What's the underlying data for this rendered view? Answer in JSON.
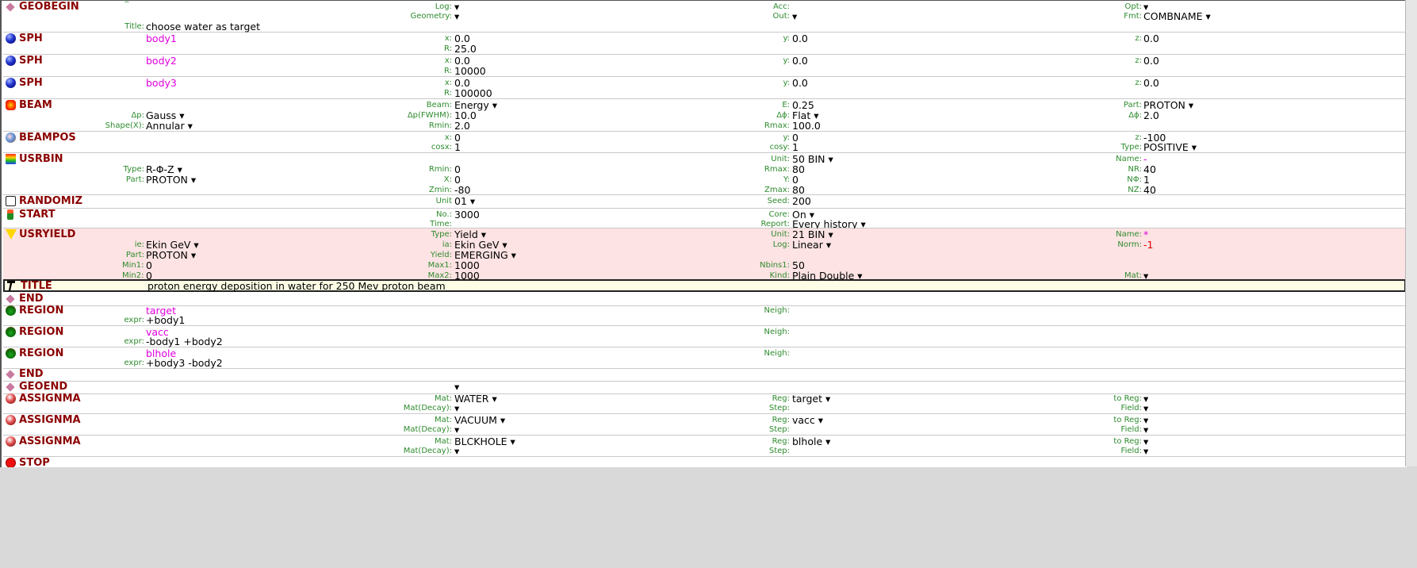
{
  "cards": {
    "geobegin": {
      "name": "GEOBEGIN",
      "log_label": "Log:",
      "log_value": "▾",
      "acc_label": "Acc:",
      "opt_label": "Opt:",
      "opt_value": "▾",
      "geometry_label": "Geometry:",
      "geometry_value": "▾",
      "out_label": "Out:",
      "out_value": "▾",
      "fmt_label": "Fmt:",
      "fmt_value": "COMBNAME ▾",
      "title_label": "Title:",
      "title_value": "choose water as target"
    },
    "sph1": {
      "name": "SPH",
      "id": "body1",
      "x_label": "x:",
      "x": "0.0",
      "y_label": "y:",
      "y": "0.0",
      "z_label": "z:",
      "z": "0.0",
      "r_label": "R:",
      "r": "25.0"
    },
    "sph2": {
      "name": "SPH",
      "id": "body2",
      "x_label": "x:",
      "x": "0.0",
      "y_label": "y:",
      "y": "0.0",
      "z_label": "z:",
      "z": "0.0",
      "r_label": "R:",
      "r": "10000"
    },
    "sph3": {
      "name": "SPH",
      "id": "body3",
      "x_label": "x:",
      "x": "0.0",
      "y_label": "y:",
      "y": "0.0",
      "z_label": "z:",
      "z": "0.0",
      "r_label": "R:",
      "r": "100000"
    },
    "beam": {
      "name": "BEAM",
      "beam_label": "Beam:",
      "beam_value": "Energy ▾",
      "e_label": "E:",
      "e_value": "0.25",
      "part_label": "Part:",
      "part_value": "PROTON ▾",
      "dp_label": "Δp:",
      "dp_value": "Gauss ▾",
      "dpfwhm_label": "Δp(FWHM):",
      "dpfwhm_value": "10.0",
      "dphi_label": "Δϕ:",
      "dphi_value": "Flat ▾",
      "dphi2_label": "Δϕ:",
      "dphi2_value": "2.0",
      "shape_label": "Shape(X):",
      "shape_value": "Annular ▾",
      "rmin_label": "Rmin:",
      "rmin_value": "2.0",
      "rmax_label": "Rmax:",
      "rmax_value": "100.0"
    },
    "beampos": {
      "name": "BEAMPOS",
      "x_label": "x:",
      "x": "0",
      "y_label": "y:",
      "y": "0",
      "z_label": "z:",
      "z": "-100",
      "cosx_label": "cosx:",
      "cosx": "1",
      "cosy_label": "cosy:",
      "cosy": "1",
      "type_label": "Type:",
      "type_value": "POSITIVE ▾"
    },
    "usrbin": {
      "name": "USRBIN",
      "unit_label": "Unit:",
      "unit_value": "50 BIN ▾",
      "name_label": "Name:",
      "name_value": "-",
      "type_label": "Type:",
      "type_value": "R-Φ-Z ▾",
      "rmin_label": "Rmin:",
      "rmin_value": "0",
      "rmax_label": "Rmax:",
      "rmax_value": "80",
      "nr_label": "NR:",
      "nr_value": "40",
      "part_label": "Part:",
      "part_value": "PROTON ▾",
      "x_label": "X:",
      "x_value": "0",
      "y_label": "Y:",
      "y_value": "0",
      "nphi_label": "NΦ:",
      "nphi_value": "1",
      "zmin_label": "Zmin:",
      "zmin_value": "-80",
      "zmax_label": "Zmax:",
      "zmax_value": "80",
      "nz_label": "NZ:",
      "nz_value": "40"
    },
    "randomiz": {
      "name": "RANDOMIZ",
      "unit_label": "Unit",
      "unit_value": "01 ▾",
      "seed_label": "Seed:",
      "seed_value": "200"
    },
    "start": {
      "name": "START",
      "no_label": "No.:",
      "no_value": "3000",
      "core_label": "Core:",
      "core_value": "On ▾",
      "time_label": "Time:",
      "report_label": "Report:",
      "report_value": "Every history ▾"
    },
    "usryield": {
      "name": "USRYIELD",
      "type_label": "Type:",
      "type_value": "Yield ▾",
      "unit_label": "Unit:",
      "unit_value": "21 BIN ▾",
      "name_label": "Name:",
      "name_value": "*",
      "ie_label": "ie:",
      "ie_value": "Ekin GeV ▾",
      "ia_label": "ia:",
      "ia_value": "Ekin GeV ▾",
      "log_label": "Log:",
      "log_value": "Linear ▾",
      "norm_label": "Norm:",
      "norm_value": "-1",
      "part_label": "Part:",
      "part_value": "PROTON ▾",
      "yield_label": "Yield:",
      "yield_value": "EMERGING ▾",
      "min1_label": "Min1:",
      "min1_value": "0",
      "max1_label": "Max1:",
      "max1_value": "1000",
      "nbins1_label": "Nbins1:",
      "nbins1_value": "50",
      "min2_label": "Min2:",
      "min2_value": "0",
      "max2_label": "Max2:",
      "max2_value": "1000",
      "kind_label": "Kind:",
      "kind_value": "Plain Double ▾",
      "mat_label": "Mat:",
      "mat_value": "▾"
    },
    "title": {
      "name": "TITLE",
      "value": "proton energy deposition in water for 250 Mev proton beam"
    },
    "end1": {
      "name": "END"
    },
    "region1": {
      "name": "REGION",
      "id": "target",
      "neigh_label": "Neigh:",
      "expr_label": "expr:",
      "expr": "+body1"
    },
    "region2": {
      "name": "REGION",
      "id": "vacc",
      "neigh_label": "Neigh:",
      "expr_label": "expr:",
      "expr": "-body1 +body2"
    },
    "region3": {
      "name": "REGION",
      "id": "blhole",
      "neigh_label": "Neigh:",
      "expr_label": "expr:",
      "expr": "+body3 -body2"
    },
    "end2": {
      "name": "END"
    },
    "geoend": {
      "name": "GEOEND",
      "value": "▾"
    },
    "assignma1": {
      "name": "ASSIGNMA",
      "mat_label": "Mat:",
      "mat": "WATER ▾",
      "reg_label": "Reg:",
      "reg": "target ▾",
      "toreg_label": "to Reg:",
      "toreg": "▾",
      "matdecay_label": "Mat(Decay):",
      "matdecay": "▾",
      "step_label": "Step:",
      "field_label": "Field:",
      "field": "▾"
    },
    "assignma2": {
      "name": "ASSIGNMA",
      "mat_label": "Mat:",
      "mat": "VACUUM ▾",
      "reg_label": "Reg:",
      "reg": "vacc ▾",
      "toreg_label": "to Reg:",
      "toreg": "▾",
      "matdecay_label": "Mat(Decay):",
      "matdecay": "▾",
      "step_label": "Step:",
      "field_label": "Field:",
      "field": "▾"
    },
    "assignma3": {
      "name": "ASSIGNMA",
      "mat_label": "Mat:",
      "mat": "BLCKHOLE ▾",
      "reg_label": "Reg:",
      "reg": "blhole ▾",
      "toreg_label": "to Reg:",
      "toreg": "▾",
      "matdecay_label": "Mat(Decay):",
      "matdecay": "▾",
      "step_label": "Step:",
      "field_label": "Field:",
      "field": "▾"
    },
    "stop": {
      "name": "STOP"
    }
  },
  "icons": {
    "geobegin": "geobegin-icon",
    "sph": "sphere-icon",
    "beam": "beam-icon",
    "beampos": "beampos-icon",
    "usrbin": "usrbin-icon",
    "randomiz": "dice-icon",
    "start": "start-icon",
    "usryield": "usryield-icon",
    "title": "title-icon",
    "end": "end-icon",
    "region": "region-icon",
    "assignma": "assignma-icon",
    "stop": "stop-icon"
  },
  "colors": {
    "card_name": "#8b0000",
    "label": "#2e8b2e",
    "id": "#e000e0",
    "highlight": "#fde3e3",
    "selected": "#fefee6"
  }
}
